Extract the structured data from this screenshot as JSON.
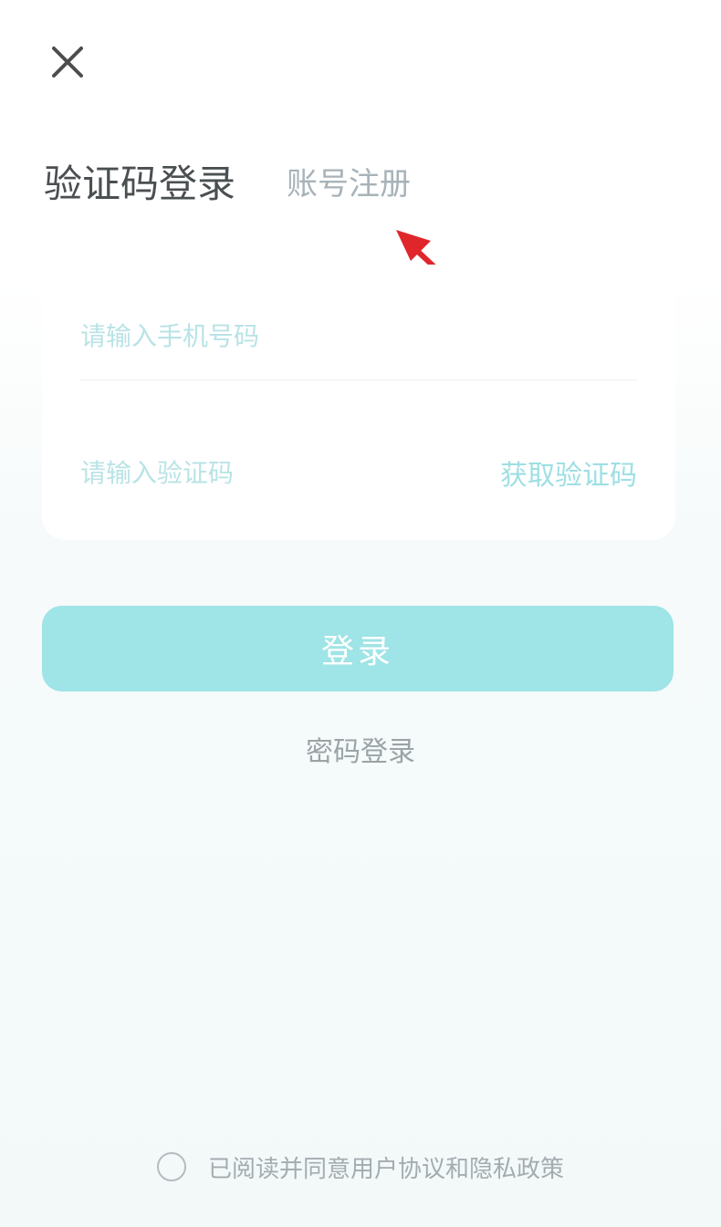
{
  "header": {
    "close_icon": "close-icon"
  },
  "tabs": {
    "active_label": "验证码登录",
    "inactive_label": "账号注册"
  },
  "form": {
    "phone_placeholder": "请输入手机号码",
    "code_placeholder": "请输入验证码",
    "get_code_label": "获取验证码"
  },
  "actions": {
    "login_label": "登录",
    "password_login_label": "密码登录"
  },
  "agreement": {
    "text": "已阅读并同意用户协议和隐私政策"
  },
  "colors": {
    "accent": "#9fe4e6",
    "accent_text": "#9edfe3",
    "annotation": "#e0262b"
  }
}
